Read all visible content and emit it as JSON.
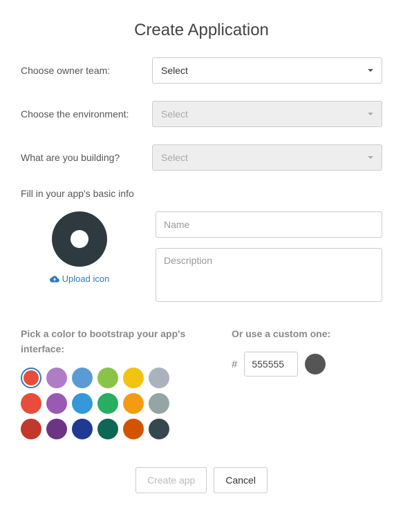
{
  "title": "Create Application",
  "fields": {
    "owner_team": {
      "label": "Choose owner team:",
      "value": "Select"
    },
    "environment": {
      "label": "Choose the environment:",
      "value": "Select",
      "disabled": true
    },
    "building": {
      "label": "What are you building?",
      "value": "Select",
      "disabled": true
    }
  },
  "basic_info": {
    "label": "Fill in your app's basic info",
    "upload_label": "Upload icon",
    "name_placeholder": "Name",
    "description_placeholder": "Description"
  },
  "color_picker": {
    "swatch_label": "Pick a color to bootstrap your app's interface:",
    "custom_label": "Or use a custom one:",
    "custom_hash": "#",
    "custom_value": "555555",
    "preview_color": "#555555",
    "selected_index": 0,
    "swatches": [
      "#e74c3c",
      "#b07cc6",
      "#5b9bd5",
      "#8bc34a",
      "#f1c40f",
      "#aab2bd",
      "#e74c3c",
      "#9b59b6",
      "#3498db",
      "#27ae60",
      "#f39c12",
      "#95a5a6",
      "#c0392b",
      "#6c3483",
      "#1f3a93",
      "#0e6655",
      "#d35400",
      "#37474f"
    ]
  },
  "actions": {
    "create_label": "Create app",
    "cancel_label": "Cancel"
  }
}
